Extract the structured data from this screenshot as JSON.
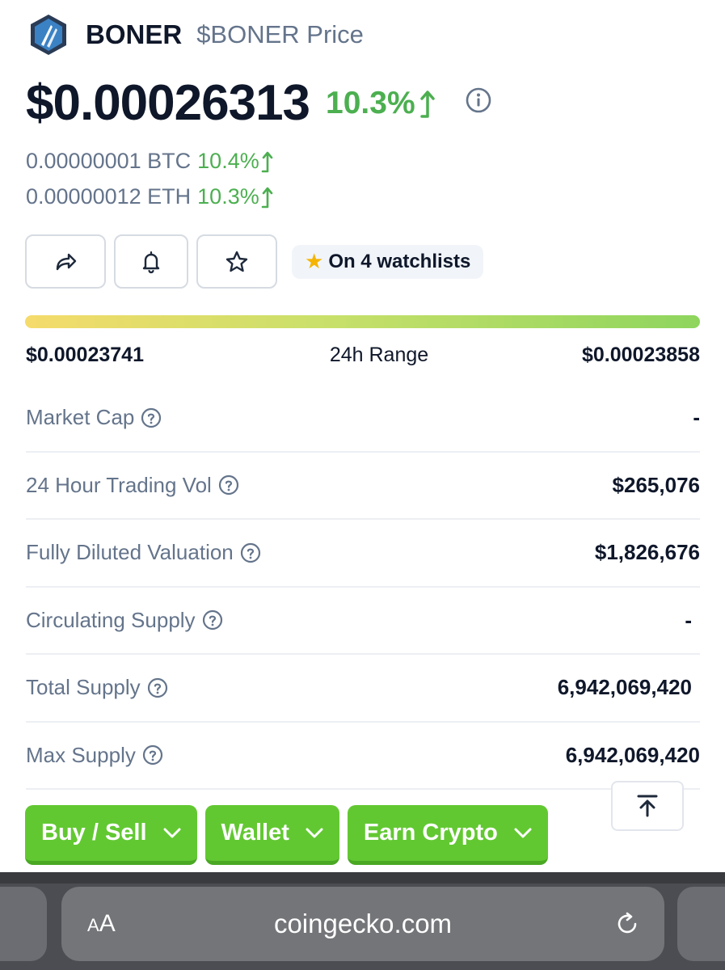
{
  "header": {
    "coin_name": "BONER",
    "coin_subtitle": "$BONER Price",
    "logo_icon": "boner-logo"
  },
  "price": {
    "usd": "$0.00026313",
    "change_24h": "10.3%",
    "change_color": "#4caf50",
    "btc_value": "0.00000001 BTC",
    "btc_change": "10.4%",
    "eth_value": "0.00000012 ETH",
    "eth_change": "10.3%"
  },
  "actions": {
    "share_icon": "share-icon",
    "alert_icon": "bell-icon",
    "watchlist_icon": "star-icon",
    "watchlist_badge": "On 4 watchlists"
  },
  "range": {
    "low": "$0.00023741",
    "label": "24h Range",
    "high": "$0.00023858"
  },
  "stats": [
    {
      "label": "Market Cap",
      "value": "-"
    },
    {
      "label": "24 Hour Trading Vol",
      "value": "$265,076"
    },
    {
      "label": "Fully Diluted Valuation",
      "value": "$1,826,676"
    },
    {
      "label": "Circulating Supply",
      "value": "-"
    },
    {
      "label": "Total Supply",
      "value": "6,942,069,420"
    },
    {
      "label": "Max Supply",
      "value": "6,942,069,420"
    }
  ],
  "cta": {
    "buy_sell": "Buy / Sell",
    "wallet": "Wallet",
    "earn": "Earn Crypto",
    "color": "#62c832"
  },
  "browser": {
    "text_size_label_big": "A",
    "text_size_label_small": "A",
    "url": "coingecko.com"
  }
}
